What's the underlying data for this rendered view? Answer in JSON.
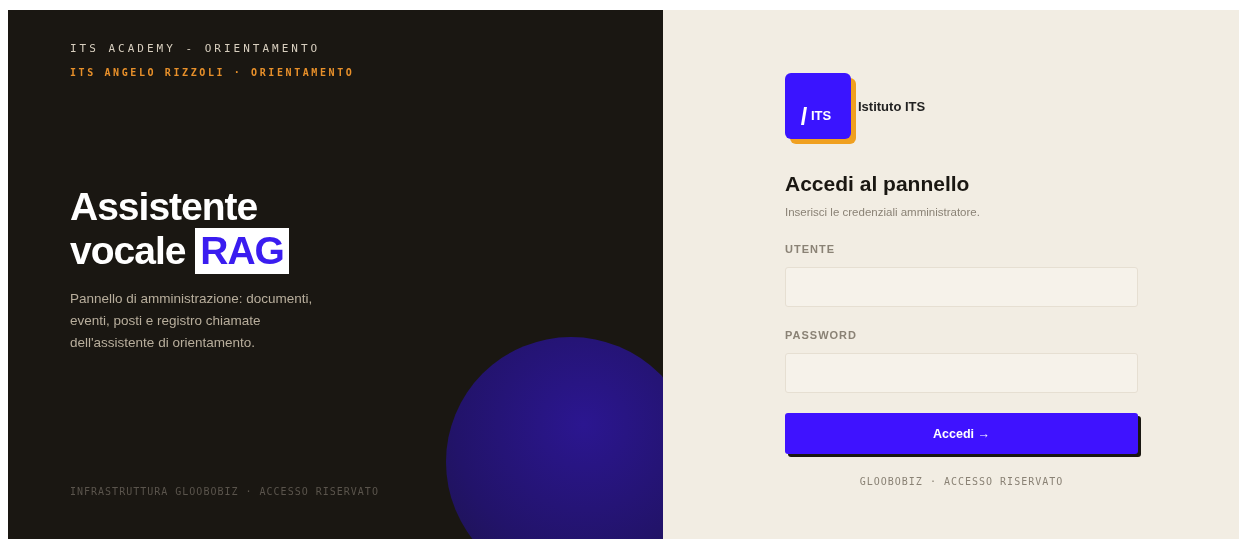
{
  "hero": {
    "eyebrow": "ITS ACADEMY - ORIENTAMENTO",
    "institute": "ITS ANGELO RIZZOLI · ORIENTAMENTO",
    "title_line_1": "Assistente",
    "title_line_2": "vocale",
    "title_highlight": "RAG",
    "description": "Pannello di amministrazione: documenti, eventi, posti e registro chiamate dell'assistente di orientamento.",
    "footer": "INFRASTRUTTURA GLOOBOBIZ · ACCESSO RISERVATO"
  },
  "login": {
    "logo_text": "ITS",
    "brand": "Istituto ITS",
    "heading": "Accedi al pannello",
    "subtitle": "Inserisci le credenziali amministratore.",
    "fields": [
      {
        "label": "UTENTE"
      },
      {
        "label": "PASSWORD"
      }
    ],
    "submit": "Accedi →",
    "footer": "GLOOBOBIZ · ACCESSO RISERVATO"
  }
}
